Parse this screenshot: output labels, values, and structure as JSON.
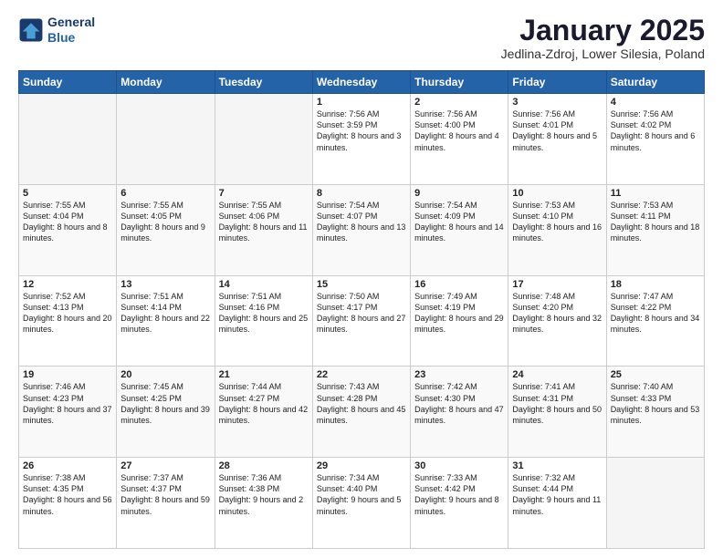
{
  "header": {
    "logo_line1": "General",
    "logo_line2": "Blue",
    "month": "January 2025",
    "location": "Jedlina-Zdroj, Lower Silesia, Poland"
  },
  "weekdays": [
    "Sunday",
    "Monday",
    "Tuesday",
    "Wednesday",
    "Thursday",
    "Friday",
    "Saturday"
  ],
  "weeks": [
    [
      {
        "day": "",
        "info": ""
      },
      {
        "day": "",
        "info": ""
      },
      {
        "day": "",
        "info": ""
      },
      {
        "day": "1",
        "info": "Sunrise: 7:56 AM\nSunset: 3:59 PM\nDaylight: 8 hours and 3 minutes."
      },
      {
        "day": "2",
        "info": "Sunrise: 7:56 AM\nSunset: 4:00 PM\nDaylight: 8 hours and 4 minutes."
      },
      {
        "day": "3",
        "info": "Sunrise: 7:56 AM\nSunset: 4:01 PM\nDaylight: 8 hours and 5 minutes."
      },
      {
        "day": "4",
        "info": "Sunrise: 7:56 AM\nSunset: 4:02 PM\nDaylight: 8 hours and 6 minutes."
      }
    ],
    [
      {
        "day": "5",
        "info": "Sunrise: 7:55 AM\nSunset: 4:04 PM\nDaylight: 8 hours and 8 minutes."
      },
      {
        "day": "6",
        "info": "Sunrise: 7:55 AM\nSunset: 4:05 PM\nDaylight: 8 hours and 9 minutes."
      },
      {
        "day": "7",
        "info": "Sunrise: 7:55 AM\nSunset: 4:06 PM\nDaylight: 8 hours and 11 minutes."
      },
      {
        "day": "8",
        "info": "Sunrise: 7:54 AM\nSunset: 4:07 PM\nDaylight: 8 hours and 13 minutes."
      },
      {
        "day": "9",
        "info": "Sunrise: 7:54 AM\nSunset: 4:09 PM\nDaylight: 8 hours and 14 minutes."
      },
      {
        "day": "10",
        "info": "Sunrise: 7:53 AM\nSunset: 4:10 PM\nDaylight: 8 hours and 16 minutes."
      },
      {
        "day": "11",
        "info": "Sunrise: 7:53 AM\nSunset: 4:11 PM\nDaylight: 8 hours and 18 minutes."
      }
    ],
    [
      {
        "day": "12",
        "info": "Sunrise: 7:52 AM\nSunset: 4:13 PM\nDaylight: 8 hours and 20 minutes."
      },
      {
        "day": "13",
        "info": "Sunrise: 7:51 AM\nSunset: 4:14 PM\nDaylight: 8 hours and 22 minutes."
      },
      {
        "day": "14",
        "info": "Sunrise: 7:51 AM\nSunset: 4:16 PM\nDaylight: 8 hours and 25 minutes."
      },
      {
        "day": "15",
        "info": "Sunrise: 7:50 AM\nSunset: 4:17 PM\nDaylight: 8 hours and 27 minutes."
      },
      {
        "day": "16",
        "info": "Sunrise: 7:49 AM\nSunset: 4:19 PM\nDaylight: 8 hours and 29 minutes."
      },
      {
        "day": "17",
        "info": "Sunrise: 7:48 AM\nSunset: 4:20 PM\nDaylight: 8 hours and 32 minutes."
      },
      {
        "day": "18",
        "info": "Sunrise: 7:47 AM\nSunset: 4:22 PM\nDaylight: 8 hours and 34 minutes."
      }
    ],
    [
      {
        "day": "19",
        "info": "Sunrise: 7:46 AM\nSunset: 4:23 PM\nDaylight: 8 hours and 37 minutes."
      },
      {
        "day": "20",
        "info": "Sunrise: 7:45 AM\nSunset: 4:25 PM\nDaylight: 8 hours and 39 minutes."
      },
      {
        "day": "21",
        "info": "Sunrise: 7:44 AM\nSunset: 4:27 PM\nDaylight: 8 hours and 42 minutes."
      },
      {
        "day": "22",
        "info": "Sunrise: 7:43 AM\nSunset: 4:28 PM\nDaylight: 8 hours and 45 minutes."
      },
      {
        "day": "23",
        "info": "Sunrise: 7:42 AM\nSunset: 4:30 PM\nDaylight: 8 hours and 47 minutes."
      },
      {
        "day": "24",
        "info": "Sunrise: 7:41 AM\nSunset: 4:31 PM\nDaylight: 8 hours and 50 minutes."
      },
      {
        "day": "25",
        "info": "Sunrise: 7:40 AM\nSunset: 4:33 PM\nDaylight: 8 hours and 53 minutes."
      }
    ],
    [
      {
        "day": "26",
        "info": "Sunrise: 7:38 AM\nSunset: 4:35 PM\nDaylight: 8 hours and 56 minutes."
      },
      {
        "day": "27",
        "info": "Sunrise: 7:37 AM\nSunset: 4:37 PM\nDaylight: 8 hours and 59 minutes."
      },
      {
        "day": "28",
        "info": "Sunrise: 7:36 AM\nSunset: 4:38 PM\nDaylight: 9 hours and 2 minutes."
      },
      {
        "day": "29",
        "info": "Sunrise: 7:34 AM\nSunset: 4:40 PM\nDaylight: 9 hours and 5 minutes."
      },
      {
        "day": "30",
        "info": "Sunrise: 7:33 AM\nSunset: 4:42 PM\nDaylight: 9 hours and 8 minutes."
      },
      {
        "day": "31",
        "info": "Sunrise: 7:32 AM\nSunset: 4:44 PM\nDaylight: 9 hours and 11 minutes."
      },
      {
        "day": "",
        "info": ""
      }
    ]
  ]
}
